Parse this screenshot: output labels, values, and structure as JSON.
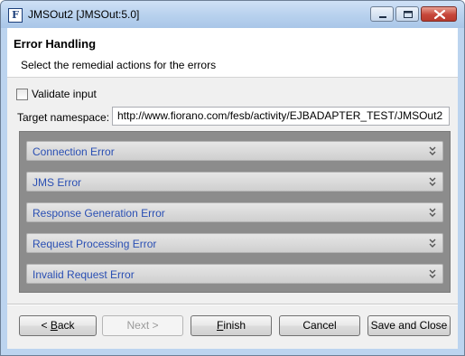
{
  "window": {
    "title": "JMSOut2 [JMSOut:5.0]",
    "app_icon_letter": "F"
  },
  "header": {
    "title": "Error Handling",
    "subtitle": "Select the remedial actions for the errors"
  },
  "form": {
    "validate_input_label": "Validate input",
    "validate_input_checked": false,
    "target_namespace_label": "Target namespace:",
    "target_namespace_value": "http://www.fiorano.com/fesb/activity/EJBADAPTER_TEST/JMSOut2"
  },
  "sections": [
    {
      "label": "Connection Error"
    },
    {
      "label": "JMS Error"
    },
    {
      "label": "Response Generation Error"
    },
    {
      "label": "Request Processing Error"
    },
    {
      "label": "Invalid Request Error"
    }
  ],
  "buttons": {
    "back": {
      "prefix": "< ",
      "mnemonic": "B",
      "rest": "ack",
      "enabled": true
    },
    "next": {
      "label": "Next >",
      "enabled": false
    },
    "finish": {
      "mnemonic": "F",
      "rest": "inish",
      "enabled": true
    },
    "cancel": {
      "label": "Cancel",
      "enabled": true
    },
    "save_close": {
      "label": "Save and Close",
      "enabled": true
    }
  },
  "colors": {
    "section_text": "#2a4fb3",
    "panel_background": "#8c8c8c"
  }
}
